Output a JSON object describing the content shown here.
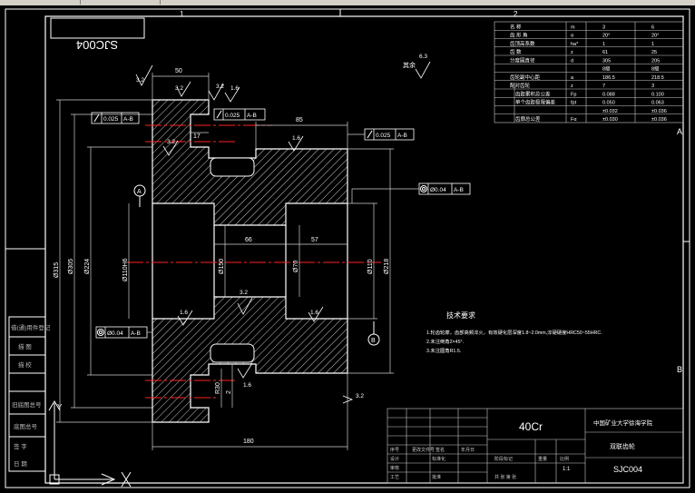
{
  "drawing_number_mirrored": "SJC004",
  "zone_labels": {
    "top": [
      "1",
      "2"
    ],
    "right": [
      "A",
      "B"
    ]
  },
  "material": "40Cr",
  "school": "中国矿业大学徐海学院",
  "part_name": "双联齿轮",
  "drawing_number": "SJC004",
  "title_block_small": [
    "序号",
    "更改文件号",
    "签名",
    "年月日",
    "设计",
    "标准化",
    "阶段标记",
    "重量",
    "比例",
    "审核",
    "工艺",
    "批准",
    "共 张 第 张"
  ],
  "ratio": "1:1",
  "dimensions": {
    "d50": "50",
    "d85": "85",
    "d17": "17",
    "d66": "66",
    "d57": "57",
    "d180": "180",
    "phi315": "Ø315",
    "phi305": "Ø305",
    "phi224": "Ø224",
    "phi110h6": "Ø110H6",
    "phi150": "Ø150",
    "phi70": "Ø70",
    "phi110": "Ø110",
    "phi218": "Ø218",
    "r30": "R30",
    "c2": "2",
    "rough_3_2": "3.2",
    "rough_1_6": "1.6",
    "rough_6_3": "6.3"
  },
  "tolerances": {
    "runout1": "0.025",
    "datum1": "A-B",
    "runout2": "0.025",
    "datum2": "A-B",
    "runout3": "0.025",
    "datum3": "A-B",
    "coax1": "Ø0.04",
    "datumc1": "A-B",
    "coax2": "Ø0.04",
    "datumc2": "A-B"
  },
  "datums": [
    "A",
    "B"
  ],
  "remaining_roughness": "其余",
  "tech_req": {
    "title": "技术要求",
    "items": [
      "1.轮齿轮廓，齿部高频淬火，有效硬化层深度1.8~2.0mm,淬硬硬度HRC50~55HRC.",
      "2.未注倒角2×45°.",
      "3.未注圆角R1.5."
    ]
  },
  "param_table": {
    "headers": [
      "名 称",
      "m",
      "3",
      "6"
    ],
    "rows": [
      [
        "齿 形 角",
        "α",
        "20°",
        "20°"
      ],
      [
        "齿顶高系数",
        "ha*",
        "1",
        "1"
      ],
      [
        "齿 数",
        "z",
        "61",
        "25"
      ],
      [
        "分度圆直径",
        "d",
        "305",
        "205"
      ],
      [
        "",
        "",
        "8级",
        "8级"
      ],
      [
        "齿轮副中心距",
        "a",
        "186.5",
        "218.5"
      ],
      [
        "配对齿轮",
        "z",
        "7",
        "3"
      ],
      [
        "齿距累积总公差",
        "Fp",
        "0.088",
        "0.100"
      ],
      [
        "单个齿距极限偏差",
        "fpt",
        "0.050",
        "0.063"
      ],
      [
        "",
        "",
        "±0.032",
        "±0.036"
      ],
      [
        "齿廓总公差",
        "Fα",
        "±0.030",
        "±0.036"
      ]
    ]
  },
  "left_labels": [
    "借(通)用件登记",
    "描 图",
    "描 校",
    "旧底图总号",
    "底图总号",
    "签 字",
    "日 期"
  ]
}
